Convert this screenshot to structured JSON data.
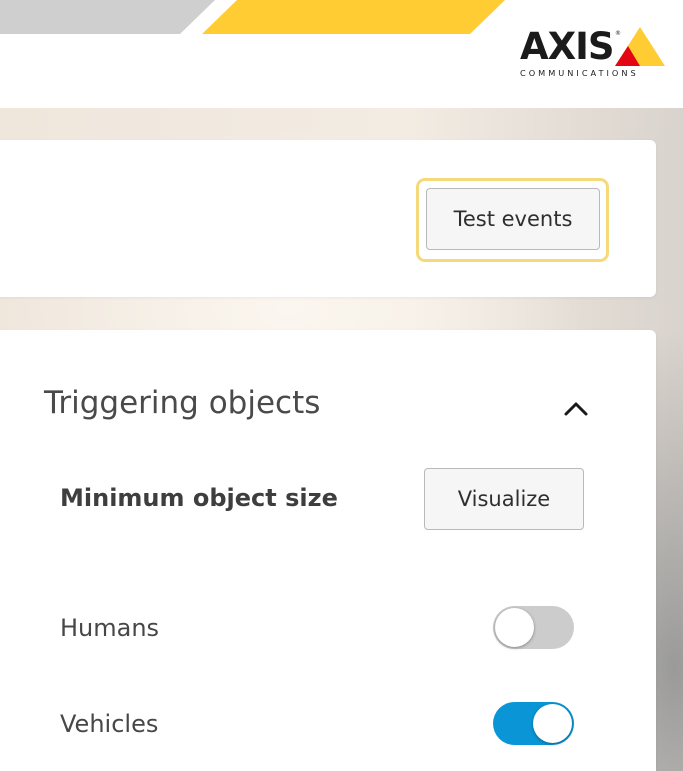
{
  "brand": {
    "logo_word": "AXIS",
    "logo_sub": "COMMUNICATIONS",
    "logo_reg": "®",
    "colors": {
      "yellow": "#ffcc33",
      "red": "#e30613",
      "dark": "#1b1b1b"
    }
  },
  "test_card": {
    "test_events_label": "Test events"
  },
  "triggering": {
    "title": "Triggering objects",
    "collapse_icon": "chevron-up-icon",
    "min_size_label": "Minimum object size",
    "visualize_label": "Visualize",
    "objects": [
      {
        "label": "Humans",
        "enabled": false
      },
      {
        "label": "Vehicles",
        "enabled": true
      }
    ]
  },
  "colors": {
    "toggle_on": "#0a96d6",
    "toggle_off": "#cccccc",
    "focus_ring": "#f6d97a"
  }
}
